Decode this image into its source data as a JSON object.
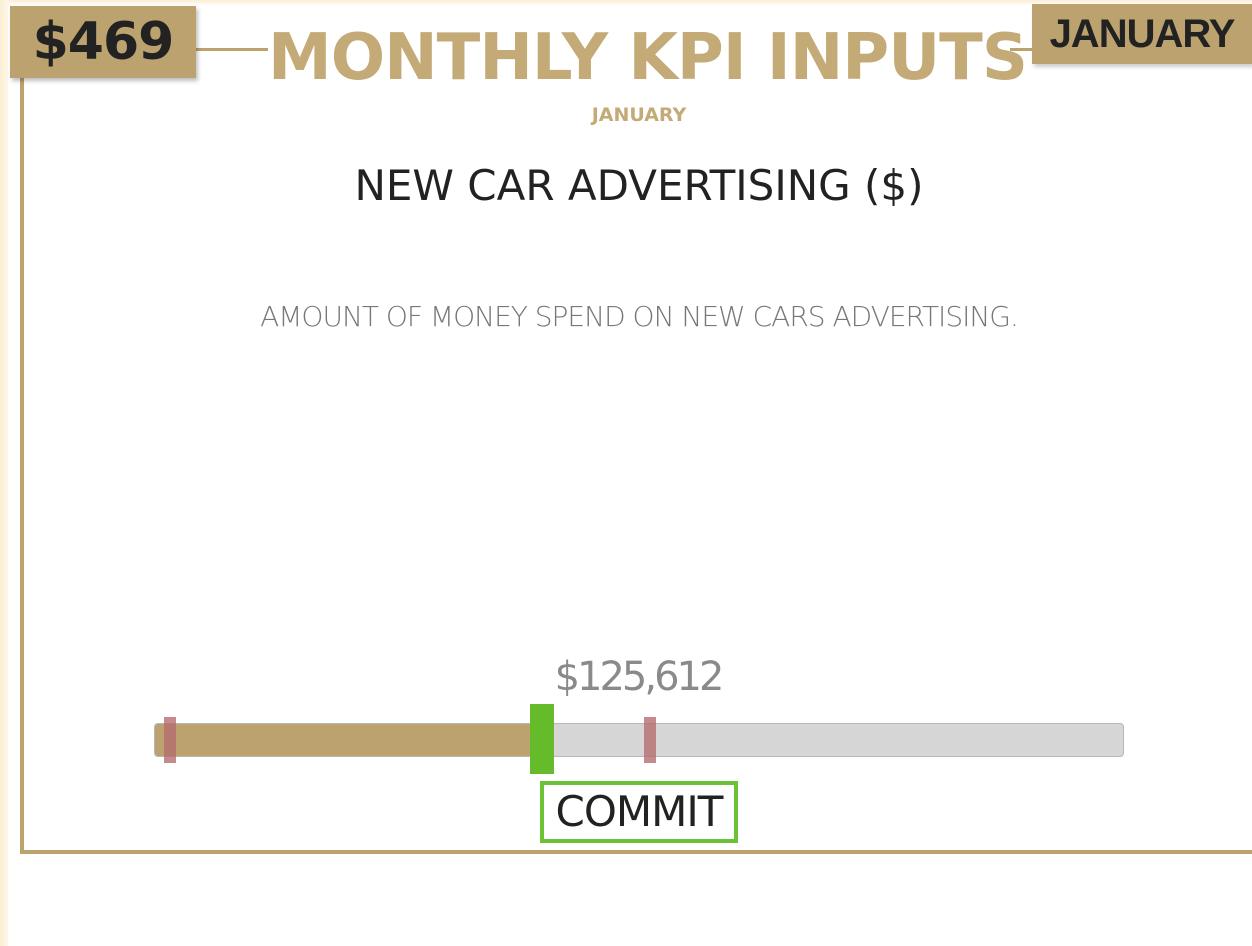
{
  "header": {
    "balance": "$469",
    "title": "MONTHLY KPI INPUTS",
    "subtitle": "JANUARY",
    "month_badge": "JANUARY"
  },
  "kpi": {
    "title": "NEW CAR ADVERTISING ($)",
    "description": "AMOUNT OF MONEY SPEND ON NEW CARS ADVERTISING."
  },
  "slider": {
    "value_label": "$125,612",
    "fill_fraction": 0.4,
    "marker_fractions": [
      0.01,
      0.505
    ],
    "colors": {
      "fill": "#bca26e",
      "track": "#d6d6d6",
      "handle": "#66bb2a",
      "marker": "#b46e6e"
    }
  },
  "actions": {
    "commit_label": "COMMIT"
  },
  "colors": {
    "accent": "#bca26e",
    "commit_border": "#6bc234"
  }
}
